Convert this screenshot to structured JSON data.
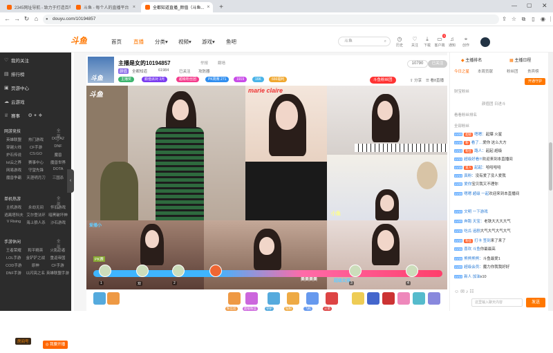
{
  "browser": {
    "tabs": [
      {
        "title": "2345网址导航 - 致力于打造百年品牌"
      },
      {
        "title": "斗鱼 - 每个人的直播平台"
      },
      {
        "title": "全都知道直播_颜值（斗鱼..."
      }
    ],
    "new_tab": "+",
    "url": "douyu.com/10194857"
  },
  "site": {
    "logo": "斗鱼",
    "nav": [
      "首页",
      "直播",
      "分类▾",
      "视频▾",
      "游戏▾",
      "鱼吧"
    ],
    "search_placeholder": "斗鱼",
    "header_icons": [
      {
        "label": "历史",
        "icon": "clock-icon"
      },
      {
        "label": "关注",
        "icon": "heart-icon"
      },
      {
        "label": "下载",
        "icon": "download-icon"
      },
      {
        "label": "客户端",
        "icon": "monitor-icon"
      },
      {
        "label": "通知",
        "icon": "bell-icon"
      },
      {
        "label": "创作",
        "icon": "pin-icon"
      }
    ],
    "notify_badge": "1"
  },
  "sidebar": {
    "top_items": [
      "我的关注",
      "排行榜",
      "页游中心",
      "云游戏",
      "赛事"
    ],
    "sections": [
      {
        "title": "网游竞技",
        "more": "全部 >",
        "items": [
          "英雄联盟",
          "热门游戏",
          "DOTA2",
          "穿越火线",
          "CF手游",
          "DNF",
          "炉石传说",
          "CS:GO",
          "魔兽",
          "lol云之界",
          "赛事中心",
          "魔兽世界",
          "网易游戏",
          "守望先锋",
          "DOTA",
          "魔兽争霸",
          "天涯明月刀",
          "三国杀"
        ]
      },
      {
        "title": "单机热游",
        "more": "全部 >",
        "items": [
          "主机游戏",
          "永劫无间",
          "怀旧游戏",
          "逃离塔科夫",
          "艾尔登法环",
          "暗黑破坏神",
          "V Rising",
          "海上狼人杀",
          "沙石游戏",
          "沙盒游戏"
        ]
      },
      {
        "title": "手游休闲",
        "more": "全部 >",
        "items": [
          "王者荣耀",
          "和平精英",
          "火影忍者",
          "LOL手游",
          "金铲铲之战",
          "重返帝国",
          "COD手游",
          "原神",
          "CF手游",
          "DNF手游",
          "以闪亮之名",
          "英雄联盟手游"
        ]
      }
    ],
    "logo": "斗鱼",
    "room_label": "房间号",
    "room_number": "10407920",
    "cta": "◎ 我要开播"
  },
  "room": {
    "title": "主播是女的10194857",
    "tag1": "举报",
    "tag2": "翻墙",
    "category": "颜值",
    "meta": [
      "全都知道",
      "61984",
      "已关注",
      "攻防器"
    ],
    "chips": [
      {
        "label": "主播奖",
        "color": "#3cb46e"
      },
      {
        "label": "颜值派对 3月",
        "color": "#7a3cf0"
      },
      {
        "label": "超级粉丝团",
        "color": "#f43c8c"
      },
      {
        "label": "PK周赛 271",
        "color": "#2f8ef0"
      },
      {
        "label": "1919",
        "color": "#c84ae8"
      },
      {
        "label": "16K",
        "color": "#4ab4e8"
      },
      {
        "label": "666福利",
        "color": "#f0a830"
      }
    ],
    "follow_count": "10790",
    "followed": "已关注",
    "fan_badge": "斗鱼粉丝团",
    "share": "分享",
    "more": "看8直播"
  },
  "player": {
    "cells": [
      {
        "label": "斗鱼"
      },
      {
        "label": "marie claire"
      },
      {
        "label": "小鱼"
      },
      {
        "label": "爱播小"
      },
      {
        "label": "美美美美"
      },
      {
        "label": "超级女孩"
      }
    ],
    "pk_names": [
      "1",
      "双",
      "2",
      "3",
      "4"
    ],
    "pk_tag": "PK赛"
  },
  "gifts": [
    {
      "label": "粉丝团",
      "color": "#e94"
    },
    {
      "label": "超级粉丝",
      "color": "#c6d"
    },
    {
      "label": "守护",
      "color": "#5ad"
    },
    {
      "label": "钻粉",
      "color": "#ea4"
    },
    {
      "label": "飞机",
      "color": "#69e"
    },
    {
      "label": "火箭",
      "color": "#d44"
    }
  ],
  "chat": {
    "tabs": [
      "主播排名",
      "主播日程"
    ],
    "subtabs": [
      "今日之星",
      "本周贡献",
      "粉丝团",
      "贵宾榜"
    ],
    "guard_btn": "开通守护",
    "lines": [
      {
        "lv": "",
        "name": "",
        "fan": "",
        "text": "财宝粉丝",
        "sys": true
      },
      {
        "lv": "",
        "name": "",
        "fan": "",
        "text": "颜值团 日进斗",
        "sys": true
      },
      {
        "lv": "",
        "name": "",
        "fan": "",
        "text": "看看粉丝排名",
        "sys": true
      },
      {
        "lv": "",
        "name": "",
        "fan": "",
        "text": "全部粉丝",
        "sys": true
      },
      {
        "lv": "LV20",
        "name": "嗯嗯：",
        "fan": "超级",
        "text": "起爆 火星"
      },
      {
        "lv": "LV16",
        "name": "看了…",
        "fan": "粉",
        "text": "爱你 这么大方"
      },
      {
        "lv": "LV14",
        "name": "路人：",
        "fan": "粉丝",
        "text": "起起 超级"
      },
      {
        "lv": "LV13",
        "name": "超级好看!!!",
        "fan": "",
        "text": "欢迎来到本直播间"
      },
      {
        "lv": "LV15",
        "name": "起起：",
        "fan": "爱人",
        "text": "哈哈哈哈"
      },
      {
        "lv": "LV14",
        "name": "真粉：",
        "fan": "",
        "text": "没有爱了没人爱我"
      },
      {
        "lv": "LV20",
        "name": "爱你",
        "fan": "",
        "text": "宝贝我又不理你"
      },
      {
        "lv": "LV15",
        "name": "嗯嗯 超级 一起",
        "fan": "",
        "text": "欢迎来到本直播间"
      },
      {
        "lv": "LV10",
        "name": "文明 一下游戏",
        "fan": "",
        "text": ""
      },
      {
        "lv": "LV20",
        "name": "奔跑 天宝：",
        "fan": "",
        "text": "老铁大大大大气"
      },
      {
        "lv": "LV15",
        "name": "吃瓜 追剧",
        "fan": "",
        "text": "大气大气大气大气"
      },
      {
        "lv": "LV15",
        "name": "打卡 签到",
        "fan": "粉丝",
        "text": "来了来了"
      },
      {
        "lv": "LV15",
        "name": "喜欢 斗鱼",
        "fan": "",
        "text": "你最最高"
      },
      {
        "lv": "LV16",
        "name": "熊熊熊熊：",
        "fan": "",
        "text": "斗鱼最爱1"
      },
      {
        "lv": "LV20",
        "name": "超级会员：",
        "fan": "",
        "text": "魔力你我我好好"
      },
      {
        "lv": "LV13",
        "name": "新人 加油",
        "fan": "",
        "text": "x10"
      }
    ],
    "input_placeholder": "这里输入聊天内容",
    "send": "发送"
  }
}
